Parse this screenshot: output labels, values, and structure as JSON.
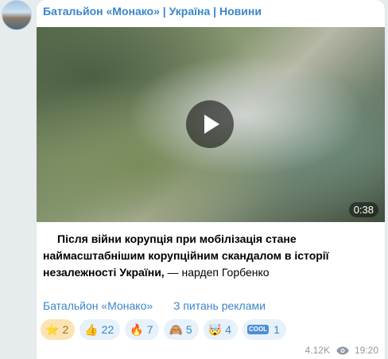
{
  "channel": {
    "title": "Батальйон «Монако» | Україна | Новини"
  },
  "video": {
    "duration": "0:38"
  },
  "post": {
    "text_bold": "Після війни корупція при мобілізація стане наймасштабнішим корупційним скандалом в історії незалежності України,",
    "text_author": " — нардеп Горбенко"
  },
  "links": {
    "channel_link": "Батальйон «Монако»",
    "ads_link": "З питань реклами"
  },
  "reactions": [
    {
      "icon": "star-icon",
      "emoji": "⭐",
      "count": "2"
    },
    {
      "icon": "thumbs-up-icon",
      "emoji": "👍",
      "count": "22"
    },
    {
      "icon": "fire-icon",
      "emoji": "🔥",
      "count": "7"
    },
    {
      "icon": "see-no-evil-monkey-icon",
      "emoji": "🙈",
      "count": "5"
    },
    {
      "icon": "exploding-head-icon",
      "emoji": "🤯",
      "count": "4"
    },
    {
      "icon": "cool-icon",
      "emoji": "COOL",
      "count": "1"
    }
  ],
  "meta": {
    "views": "4.12K",
    "time": "19:20"
  },
  "colors": {
    "accent": "#3a86c8",
    "background": "#e6ebee",
    "bubble": "#ffffff"
  }
}
